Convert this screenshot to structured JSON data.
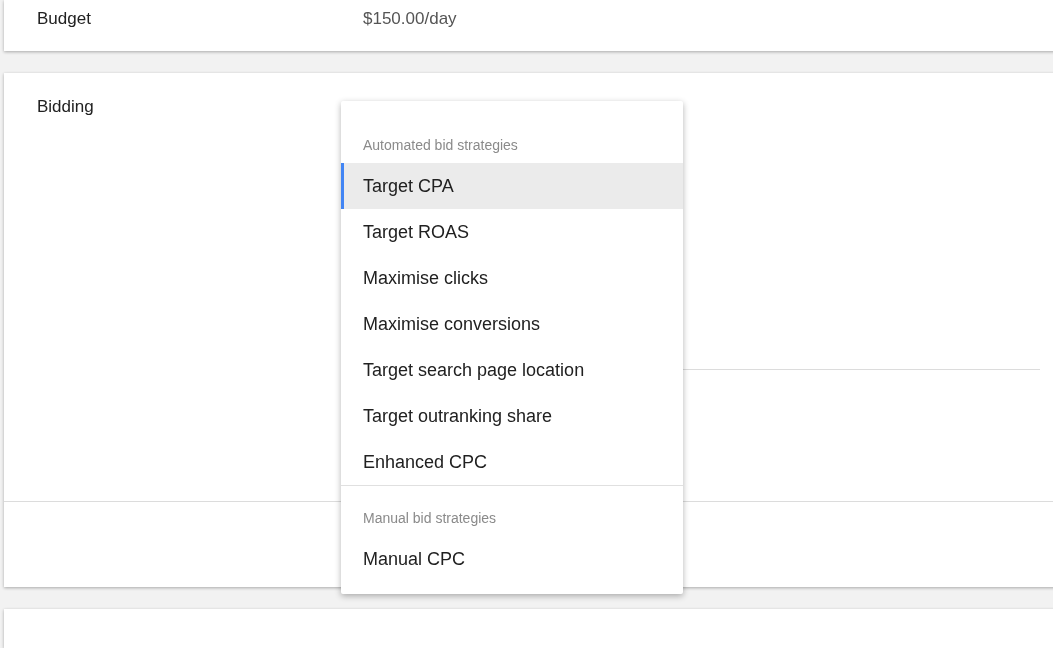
{
  "budget": {
    "label": "Budget",
    "value": "$150.00/day"
  },
  "bidding": {
    "label": "Bidding"
  },
  "menu": {
    "groups": [
      {
        "header": "Automated bid strategies",
        "items": [
          {
            "label": "Target CPA",
            "selected": true
          },
          {
            "label": "Target ROAS",
            "selected": false
          },
          {
            "label": "Maximise clicks",
            "selected": false
          },
          {
            "label": "Maximise conversions",
            "selected": false
          },
          {
            "label": "Target search page location",
            "selected": false
          },
          {
            "label": "Target outranking share",
            "selected": false
          },
          {
            "label": "Enhanced CPC",
            "selected": false
          }
        ]
      },
      {
        "header": "Manual bid strategies",
        "items": [
          {
            "label": "Manual CPC",
            "selected": false
          }
        ]
      }
    ]
  }
}
